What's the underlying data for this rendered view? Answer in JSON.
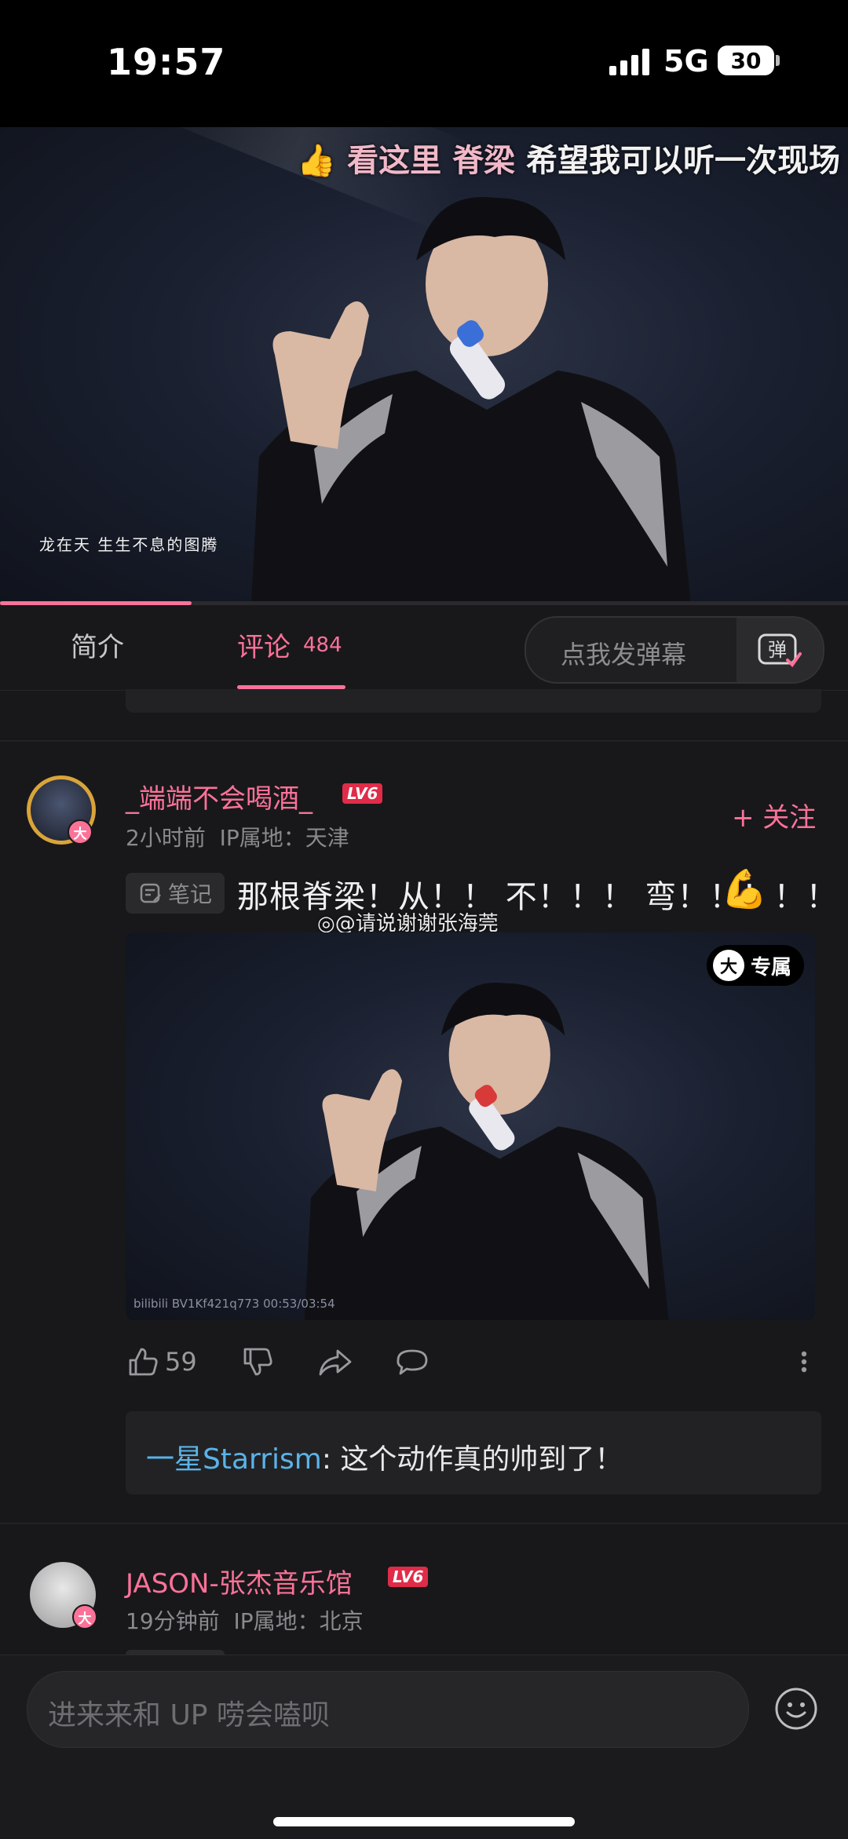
{
  "status_bar": {
    "time": "19:57",
    "network": "5G",
    "battery": "30"
  },
  "video": {
    "danmaku_prefix": "看这里",
    "danmaku_pink": "脊梁",
    "danmaku_text": "希望我可以听一次现场",
    "caption": "龙在天 生生不息的图腾",
    "progress_fraction": 0.226
  },
  "tabs": {
    "intro": "简介",
    "comments": "评论",
    "comments_count": "484",
    "danmaku_placeholder": "点我发弹幕",
    "danmaku_icon": "弹"
  },
  "comments": [
    {
      "username": "_端端不会喝酒_",
      "level": "LV6",
      "badge": "大",
      "time": "2小时前",
      "ip": "IP属地：天津",
      "follow": "+ 关注",
      "note_tag": "笔记",
      "text": "那根脊梁！从！！ 不！！！ 弯！！！！！",
      "emoji": "💪",
      "watermark": "@请说谢谢张海莞",
      "image_badge": "专属",
      "image_badge_icon": "大",
      "image_id": "bilibili BV1Kf421q773 00:53/03:54",
      "likes": "59",
      "reply": {
        "user": "一星Starrism",
        "text": ": 这个动作真的帅到了！"
      }
    },
    {
      "username": "JASON-张杰音乐馆",
      "level": "LV6",
      "badge": "大",
      "time": "19分钟前",
      "ip": "IP属地：北京"
    }
  ],
  "bottom": {
    "placeholder": "进来来和 UP 唠会嗑呗"
  },
  "colors": {
    "accent": "#fb7299",
    "reply_user": "#5ab3e8",
    "level": "#e02c49",
    "gold_ring": "#d9a43a"
  },
  "icons": [
    "signal-icon",
    "battery-icon",
    "danmaku-icon",
    "note-icon",
    "like-icon",
    "dislike-icon",
    "share-icon",
    "reply-icon",
    "more-icon",
    "emoji-icon"
  ]
}
